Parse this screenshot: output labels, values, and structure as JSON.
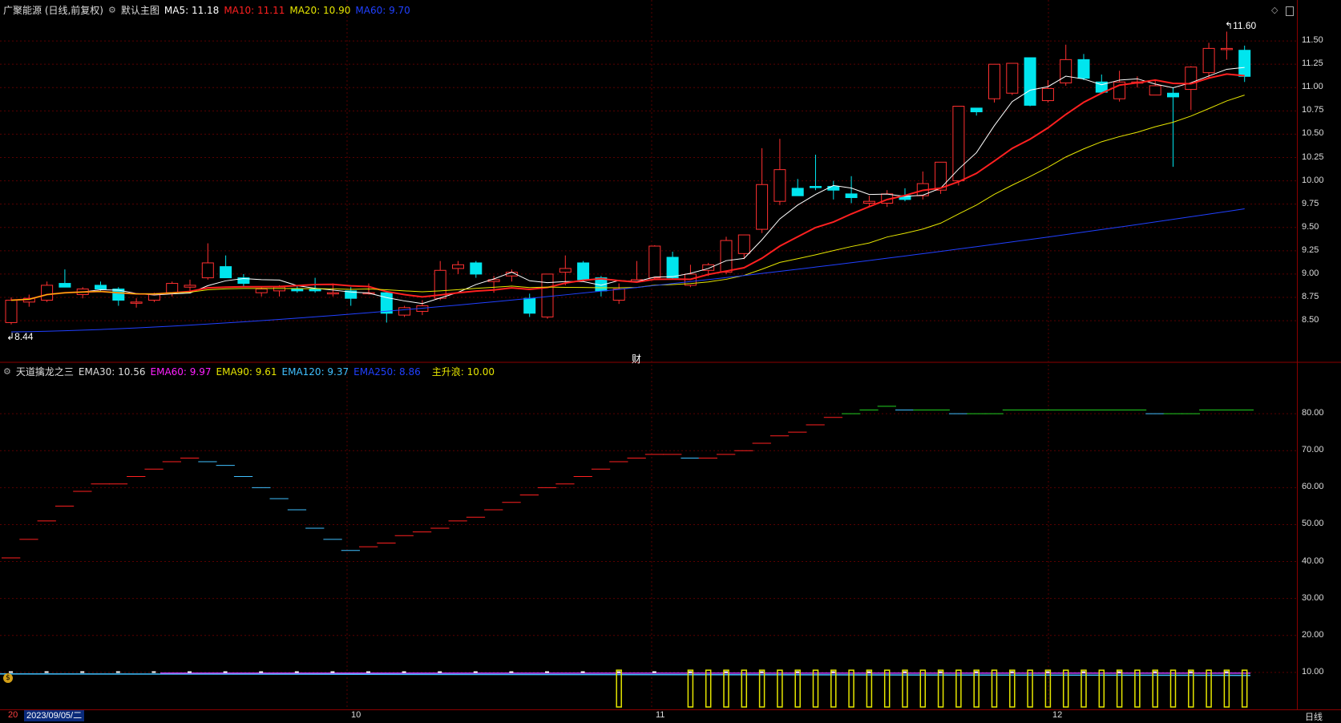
{
  "stock": {
    "title": "广聚能源 (日线,前复权)",
    "template_label": "默认主图",
    "ma5": {
      "label": "MA5: 11.18",
      "color": "#ffffff"
    },
    "ma10": {
      "label": "MA10: 11.11",
      "color": "#ff2020"
    },
    "ma20": {
      "label": "MA20: 10.90",
      "color": "#e6e600"
    },
    "ma60": {
      "label": "MA60: 9.70",
      "color": "#2040ff"
    },
    "high_mark": "11.60",
    "low_mark": "8.44",
    "event_marker": "财"
  },
  "price_axis": [
    "11.50",
    "11.25",
    "11.00",
    "10.75",
    "10.50",
    "10.25",
    "10.00",
    "9.75",
    "9.50",
    "9.25",
    "9.00",
    "8.75",
    "8.50"
  ],
  "indicator": {
    "name": "天道擒龙之三",
    "ema30": {
      "label": "EMA30: 10.56",
      "color": "#dddddd"
    },
    "ema60": {
      "label": "EMA60: 9.97",
      "color": "#ff20ff"
    },
    "ema90": {
      "label": "EMA90: 9.61",
      "color": "#e6e600"
    },
    "ema120": {
      "label": "EMA120: 9.37",
      "color": "#40c0ff"
    },
    "ema250": {
      "label": "EMA250: 8.86",
      "color": "#2040ff"
    },
    "main_wave": {
      "label": "主升浪: 10.00",
      "color": "#e6e600"
    }
  },
  "indicator_axis": [
    "80.00",
    "70.00",
    "60.00",
    "50.00",
    "40.00",
    "30.00",
    "20.00",
    "10.00"
  ],
  "bottom": {
    "date_prefix": "20",
    "current_date": "2023/09/05/二",
    "month_10": "10",
    "month_11": "11",
    "month_12": "12",
    "period": "日线"
  },
  "chart_data": {
    "type": "candlestick",
    "price_range": [
      8.2,
      11.75
    ],
    "candles": [
      [
        8.48,
        8.75,
        8.46,
        8.72
      ],
      [
        8.7,
        8.78,
        8.65,
        8.74
      ],
      [
        8.72,
        8.92,
        8.7,
        8.88
      ],
      [
        8.9,
        9.05,
        8.86,
        8.86
      ],
      [
        8.78,
        8.86,
        8.74,
        8.84
      ],
      [
        8.88,
        8.92,
        8.82,
        8.84
      ],
      [
        8.84,
        8.86,
        8.66,
        8.72
      ],
      [
        8.7,
        8.74,
        8.64,
        8.7
      ],
      [
        8.72,
        8.8,
        8.7,
        8.78
      ],
      [
        8.8,
        8.92,
        8.76,
        8.9
      ],
      [
        8.86,
        8.94,
        8.8,
        8.88
      ],
      [
        8.96,
        9.33,
        8.94,
        9.12
      ],
      [
        9.08,
        9.2,
        8.96,
        8.96
      ],
      [
        8.96,
        9.0,
        8.86,
        8.9
      ],
      [
        8.8,
        8.86,
        8.76,
        8.84
      ],
      [
        8.82,
        8.88,
        8.76,
        8.86
      ],
      [
        8.84,
        8.88,
        8.8,
        8.82
      ],
      [
        8.84,
        8.96,
        8.8,
        8.82
      ],
      [
        8.8,
        8.9,
        8.76,
        8.8
      ],
      [
        8.82,
        8.86,
        8.66,
        8.74
      ],
      [
        8.8,
        8.9,
        8.78,
        8.8
      ],
      [
        8.8,
        8.82,
        8.48,
        8.58
      ],
      [
        8.56,
        8.66,
        8.54,
        8.64
      ],
      [
        8.6,
        8.72,
        8.56,
        8.66
      ],
      [
        8.74,
        9.14,
        8.72,
        9.04
      ],
      [
        9.06,
        9.14,
        9.0,
        9.1
      ],
      [
        9.12,
        9.14,
        8.96,
        9.0
      ],
      [
        8.92,
        8.98,
        8.8,
        8.94
      ],
      [
        8.98,
        9.05,
        8.92,
        9.02
      ],
      [
        8.74,
        8.79,
        8.54,
        8.58
      ],
      [
        8.54,
        9.0,
        8.52,
        9.0
      ],
      [
        9.02,
        9.2,
        8.88,
        9.06
      ],
      [
        9.12,
        9.14,
        8.92,
        8.94
      ],
      [
        8.96,
        8.98,
        8.76,
        8.82
      ],
      [
        8.72,
        8.9,
        8.68,
        8.84
      ],
      [
        8.92,
        9.14,
        8.91,
        8.94
      ],
      [
        8.96,
        9.31,
        8.94,
        9.3
      ],
      [
        9.18,
        9.24,
        8.94,
        8.96
      ],
      [
        8.88,
        9.1,
        8.86,
        9.0
      ],
      [
        9.04,
        9.12,
        8.98,
        9.1
      ],
      [
        9.02,
        9.4,
        9.0,
        9.36
      ],
      [
        9.22,
        9.42,
        9.16,
        9.42
      ],
      [
        9.48,
        10.35,
        9.44,
        9.96
      ],
      [
        9.78,
        10.45,
        9.74,
        10.12
      ],
      [
        9.92,
        10.02,
        9.84,
        9.84
      ],
      [
        9.94,
        10.28,
        9.9,
        9.93
      ],
      [
        9.94,
        10.0,
        9.8,
        9.9
      ],
      [
        9.86,
        10.05,
        9.76,
        9.82
      ],
      [
        9.76,
        9.84,
        9.72,
        9.78
      ],
      [
        9.76,
        9.9,
        9.72,
        9.86
      ],
      [
        9.84,
        9.92,
        9.78,
        9.8
      ],
      [
        9.84,
        10.1,
        9.8,
        9.97
      ],
      [
        9.9,
        10.08,
        9.86,
        10.2
      ],
      [
        10.0,
        10.23,
        9.95,
        10.8
      ],
      [
        10.78,
        10.78,
        10.7,
        10.74
      ],
      [
        10.88,
        11.08,
        10.84,
        11.25
      ],
      [
        10.94,
        11.26,
        10.92,
        11.26
      ],
      [
        11.32,
        11.28,
        10.8,
        10.81
      ],
      [
        10.86,
        11.08,
        10.84,
        10.99
      ],
      [
        11.05,
        11.46,
        11.02,
        11.3
      ],
      [
        11.3,
        11.36,
        11.08,
        11.1
      ],
      [
        11.06,
        11.14,
        10.95,
        10.95
      ],
      [
        10.88,
        11.18,
        10.85,
        11.06
      ],
      [
        11.06,
        11.12,
        11.0,
        11.06
      ],
      [
        10.92,
        11.08,
        10.94,
        11.02
      ],
      [
        10.94,
        11.0,
        10.15,
        10.9
      ],
      [
        10.98,
        11.23,
        10.76,
        11.22
      ],
      [
        11.16,
        11.48,
        11.1,
        11.42
      ],
      [
        11.42,
        11.6,
        11.3,
        11.42
      ],
      [
        11.4,
        11.45,
        11.06,
        11.12
      ]
    ]
  }
}
